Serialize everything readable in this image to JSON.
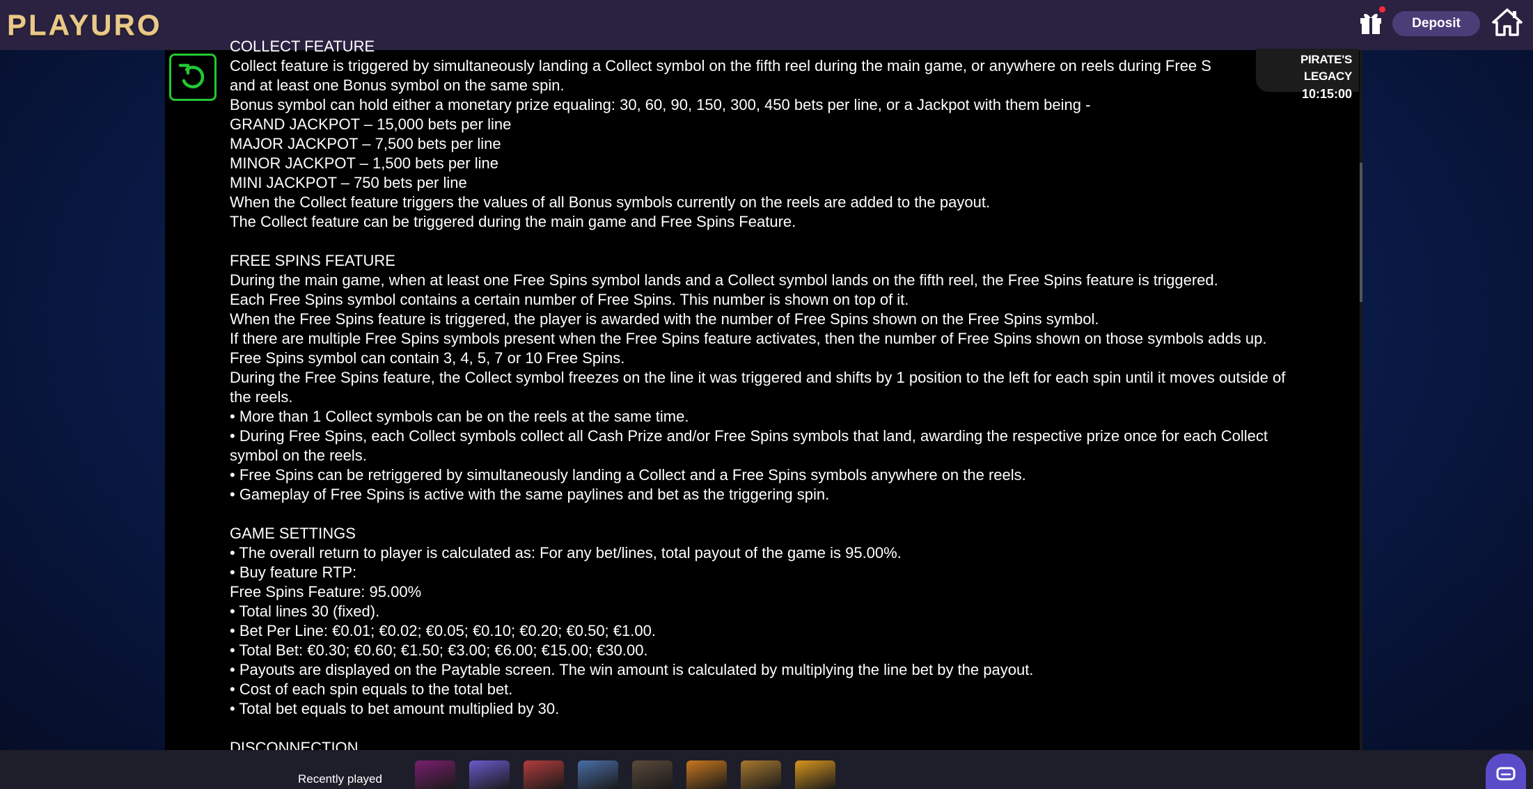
{
  "header": {
    "logo_text": "PLAYURO",
    "deposit_label": "Deposit",
    "gift_icon": "gift-icon",
    "home_icon": "home-icon",
    "accent_color": "#4a3d78"
  },
  "game_badge": {
    "name": "PIRATE'S LEGACY",
    "time": "10:15:00"
  },
  "back_button": {
    "icon": "back-arrow-icon",
    "color": "#22c832"
  },
  "content": {
    "lines": [
      "COLLECT FEATURE",
      "Collect feature is triggered by simultaneously landing a Collect symbol on the fifth reel during the main game, or anywhere on reels during Free S",
      "and at least one Bonus symbol on the same spin.",
      "Bonus symbol can hold either a monetary prize equaling: 30, 60, 90, 150, 300, 450 bets per line, or a Jackpot with them being -",
      "GRAND JACKPOT – 15,000 bets per line",
      "MAJOR JACKPOT – 7,500 bets per line",
      "MINOR JACKPOT – 1,500 bets per line",
      "MINI JACKPOT – 750 bets per line",
      "When the Collect feature triggers the values of all Bonus symbols currently on the reels are added to the payout.",
      "The Collect feature can be triggered during the main game and Free Spins Feature.",
      "",
      "FREE SPINS FEATURE",
      "During the main game, when at least one Free Spins symbol lands and a Collect symbol lands on the fifth reel, the Free Spins feature is triggered.",
      "Each Free Spins symbol contains a certain number of Free Spins. This number is shown on top of it.",
      "When the Free Spins feature is triggered, the player is awarded with the number of Free Spins shown on the Free Spins symbol.",
      "If there are multiple Free Spins symbols present when the Free Spins feature activates, then the number of Free Spins shown on those symbols adds up.",
      "Free Spins symbol can contain 3, 4, 5, 7 or 10 Free Spins.",
      "During the Free Spins feature, the Collect symbol freezes on the line it was triggered and shifts by 1 position to the left for each spin until it moves outside of",
      "the reels.",
      "• More than 1 Collect symbols can be on the reels at the same time.",
      "• During Free Spins, each Collect symbols collect all Cash Prize and/or Free Spins symbols that land, awarding the respective prize once for each Collect",
      "symbol on the reels.",
      "• Free Spins can be retriggered by simultaneously landing a Collect and a Free Spins symbols anywhere on the reels.",
      "• Gameplay of Free Spins is active with the same paylines and bet as the triggering spin.",
      "",
      "GAME SETTINGS",
      "• The overall return to player is calculated as: For any bet/lines, total payout of the game is 95.00%.",
      "• Buy feature RTP:",
      "Free Spins Feature: 95.00%",
      "• Total lines 30 (fixed).",
      "• Bet Per Line:  €0.01; €0.02; €0.05; €0.10; €0.20; €0.50; €1.00.",
      "• Total Bet:  €0.30; €0.60; €1.50; €3.00; €6.00; €15.00; €30.00.",
      "• Payouts are displayed on the Paytable screen. The win amount is calculated by multiplying the line bet by the payout.",
      "• Cost of each spin equals to the total bet.",
      "• Total bet equals to bet amount multiplied by 30.",
      "",
      "DISCONNECTION"
    ]
  },
  "footer": {
    "recently_played_label": "Recently played",
    "chat_icon": "chat-icon",
    "thumbnails": [
      {
        "name": "recent-game-1",
        "color": "#7a1e6e"
      },
      {
        "name": "recent-game-2",
        "color": "#6a5acd"
      },
      {
        "name": "recent-game-3",
        "color": "#b43c3c"
      },
      {
        "name": "recent-game-4",
        "color": "#4a6ea8"
      },
      {
        "name": "recent-game-5",
        "color": "#5a4a3a"
      },
      {
        "name": "recent-game-6",
        "color": "#c8781e"
      },
      {
        "name": "recent-game-7",
        "color": "#a8782e"
      },
      {
        "name": "recent-game-8",
        "color": "#d8961e"
      }
    ]
  }
}
